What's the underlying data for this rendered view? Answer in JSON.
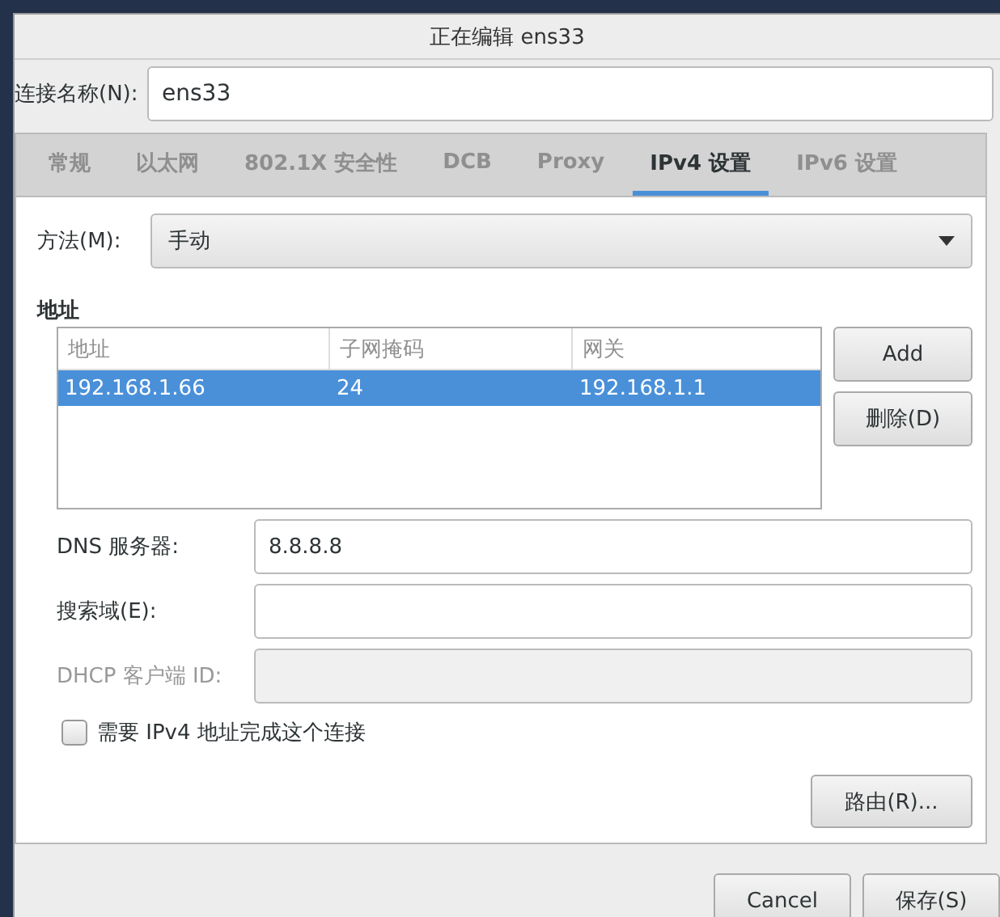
{
  "window": {
    "title": "正在编辑 ens33"
  },
  "connection_name": {
    "label": "连接名称(N):",
    "value": "ens33"
  },
  "tabs": [
    {
      "label": "常规",
      "selected": false
    },
    {
      "label": "以太网",
      "selected": false
    },
    {
      "label": "802.1X 安全性",
      "selected": false
    },
    {
      "label": "DCB",
      "selected": false
    },
    {
      "label": "Proxy",
      "selected": false
    },
    {
      "label": "IPv4 设置",
      "selected": true
    },
    {
      "label": "IPv6 设置",
      "selected": false
    }
  ],
  "method": {
    "label": "方法(M):",
    "value": "手动"
  },
  "addresses": {
    "heading": "地址",
    "columns": [
      "地址",
      "子网掩码",
      "网关"
    ],
    "rows": [
      {
        "cells": [
          "192.168.1.66",
          "24",
          "192.168.1.1"
        ],
        "selected": true
      }
    ],
    "buttons": [
      "Add",
      "删除(D)"
    ]
  },
  "fields": [
    {
      "label": "DNS 服务器:",
      "value": "8.8.8.8",
      "disabled": false
    },
    {
      "label": "搜索域(E):",
      "disabled": false
    },
    {
      "label": "DHCP 客户端 ID:",
      "disabled": true
    }
  ],
  "require_ipv4": {
    "label": "需要 IPv4 地址完成这个连接",
    "checked": false
  },
  "routes_button": "路由(R)...",
  "dialog_buttons": [
    "Cancel",
    "保存(S)"
  ]
}
